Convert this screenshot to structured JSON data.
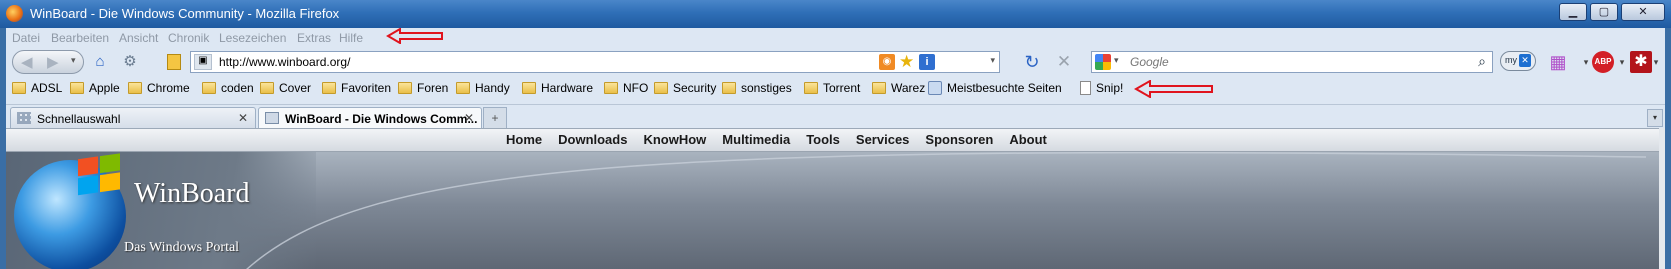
{
  "window": {
    "title": "WinBoard - Die Windows Community - Mozilla Firefox"
  },
  "menubar": {
    "items": [
      "Datei",
      "Bearbeiten",
      "Ansicht",
      "Chronik",
      "Lesezeichen",
      "Extras",
      "Hilfe"
    ]
  },
  "navbar": {
    "url": "http://www.winboard.org/",
    "search_placeholder": "Google"
  },
  "bookmarks": [
    "ADSL",
    "Apple",
    "Chrome",
    "coden",
    "Cover",
    "Favoriten",
    "Foren",
    "Handy",
    "Hardware",
    "NFO",
    "Security",
    "sonstiges",
    "Torrent",
    "Warez",
    "Meistbesuchte Seiten",
    "Snip!"
  ],
  "tabs": [
    {
      "label": "Schnellauswahl",
      "active": false
    },
    {
      "label": "WinBoard - Die Windows Comm...",
      "active": true
    }
  ],
  "site": {
    "nav": [
      "Home",
      "Downloads",
      "KnowHow",
      "Multimedia",
      "Tools",
      "Services",
      "Sponsoren",
      "About"
    ],
    "title": "WinBoard",
    "subtitle": "Das Windows Portal"
  },
  "colors": {
    "annotation_arrow": "#e0141e",
    "titlebar": "#2f6fb7",
    "chrome": "#dde7f3"
  }
}
